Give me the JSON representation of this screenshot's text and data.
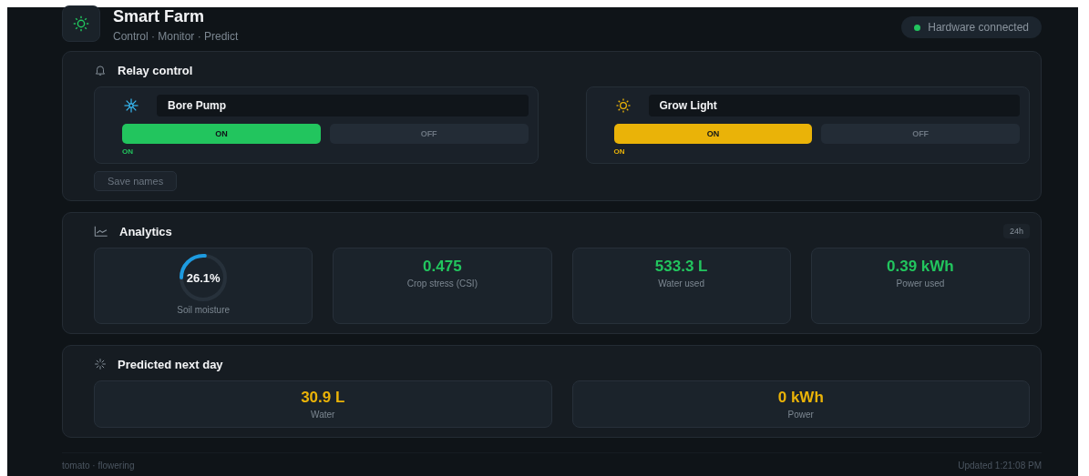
{
  "header": {
    "title": "Smart Farm",
    "subtitle": "Control · Monitor · Predict",
    "status": {
      "label": "Hardware connected",
      "connected": true
    }
  },
  "relay_panel": {
    "title": "Relay control",
    "relays": [
      {
        "name": "Bore Pump",
        "kind": "pump",
        "color": "#22c55e",
        "buttons": [
          {
            "label": "ON",
            "selected": true
          },
          {
            "label": "OFF",
            "selected": false
          }
        ],
        "state_text": "ON"
      },
      {
        "name": "Grow Light",
        "kind": "light",
        "color": "#eab308",
        "buttons": [
          {
            "label": "ON",
            "selected": true
          },
          {
            "label": "OFF",
            "selected": false
          }
        ],
        "state_text": "ON"
      }
    ],
    "save_button": "Save names"
  },
  "analytics": {
    "title": "Analytics",
    "range": "24h",
    "gauge": {
      "value": "26.1%",
      "label": "Soil moisture",
      "level": 0.261
    },
    "stats": [
      {
        "value": "0.475",
        "label": "Crop stress (CSI)"
      },
      {
        "value": "533.3 L",
        "label": "Water used"
      },
      {
        "value": "0.39 kWh",
        "label": "Power used"
      }
    ]
  },
  "prediction": {
    "title": "Predicted next day",
    "stats": [
      {
        "value": "30.9 L",
        "label": "Water"
      },
      {
        "value": "0 kWh",
        "label": "Power"
      }
    ]
  },
  "footer": {
    "left": "tomato · flowering",
    "right": "Updated 1:21:08 PM"
  }
}
